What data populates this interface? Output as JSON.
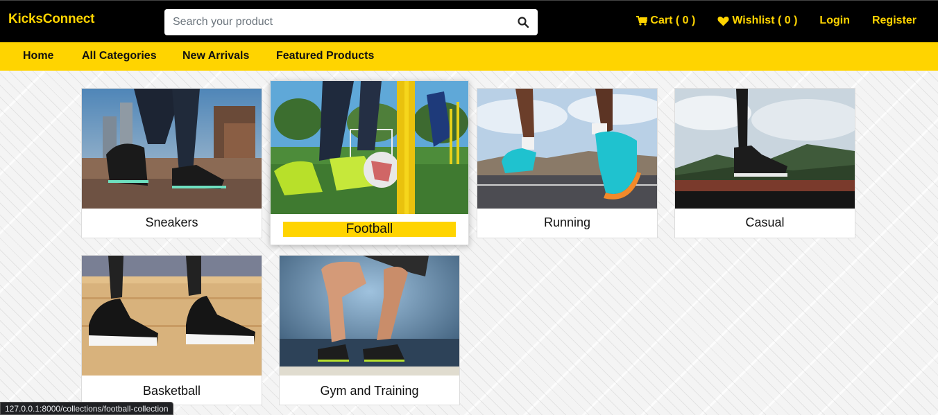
{
  "header": {
    "brand": "KicksConnect",
    "search_placeholder": "Search your product",
    "links": {
      "cart": "Cart ( 0 )",
      "wishlist": "Wishlist ( 0 )",
      "login": "Login",
      "register": "Register"
    }
  },
  "nav": {
    "home": "Home",
    "all_categories": "All Categories",
    "new_arrivals": "New Arrivals",
    "featured_products": "Featured Products"
  },
  "categories": [
    {
      "name": "Sneakers"
    },
    {
      "name": "Football"
    },
    {
      "name": "Running"
    },
    {
      "name": "Casual"
    },
    {
      "name": "Basketball"
    },
    {
      "name": "Gym and Training"
    }
  ],
  "status_url": "127.0.0.1:8000/collections/football-collection",
  "colors": {
    "accent": "#ffd400",
    "topbar_bg": "#000000"
  }
}
